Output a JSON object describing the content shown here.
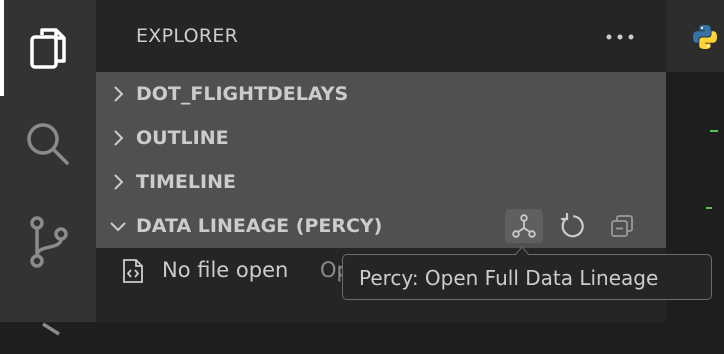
{
  "activity_bar": {
    "items": [
      {
        "icon": "files-icon",
        "active": true
      },
      {
        "icon": "search-icon",
        "active": false
      },
      {
        "icon": "source-control-icon",
        "active": false
      },
      {
        "icon": "run-debug-icon",
        "active": false
      }
    ]
  },
  "sidebar": {
    "title": "EXPLORER",
    "more_icon": "ellipsis-icon",
    "sections": [
      {
        "label": "DOT_FLIGHTDELAYS",
        "expanded": false
      },
      {
        "label": "OUTLINE",
        "expanded": false
      },
      {
        "label": "TIMELINE",
        "expanded": false
      },
      {
        "label": "DATA LINEAGE (PERCY)",
        "expanded": true
      }
    ],
    "section_actions": [
      {
        "icon": "lineage-icon",
        "hovered": true
      },
      {
        "icon": "refresh-icon",
        "hovered": false
      },
      {
        "icon": "collapse-all-icon",
        "hovered": false
      }
    ],
    "file_row": {
      "icon": "code-file-icon",
      "label": "No file open",
      "hint": "Op"
    }
  },
  "editor": {
    "tab_icon": "python-icon"
  },
  "tooltip": {
    "text": "Percy: Open Full Data Lineage"
  },
  "colors": {
    "activity_bar": "#333333",
    "sidebar": "#252526",
    "section_bg": "#505050",
    "text": "#cccccc",
    "python_blue": "#3572a5",
    "python_yellow": "#ffd43b",
    "green_mark": "#4ec94e"
  }
}
